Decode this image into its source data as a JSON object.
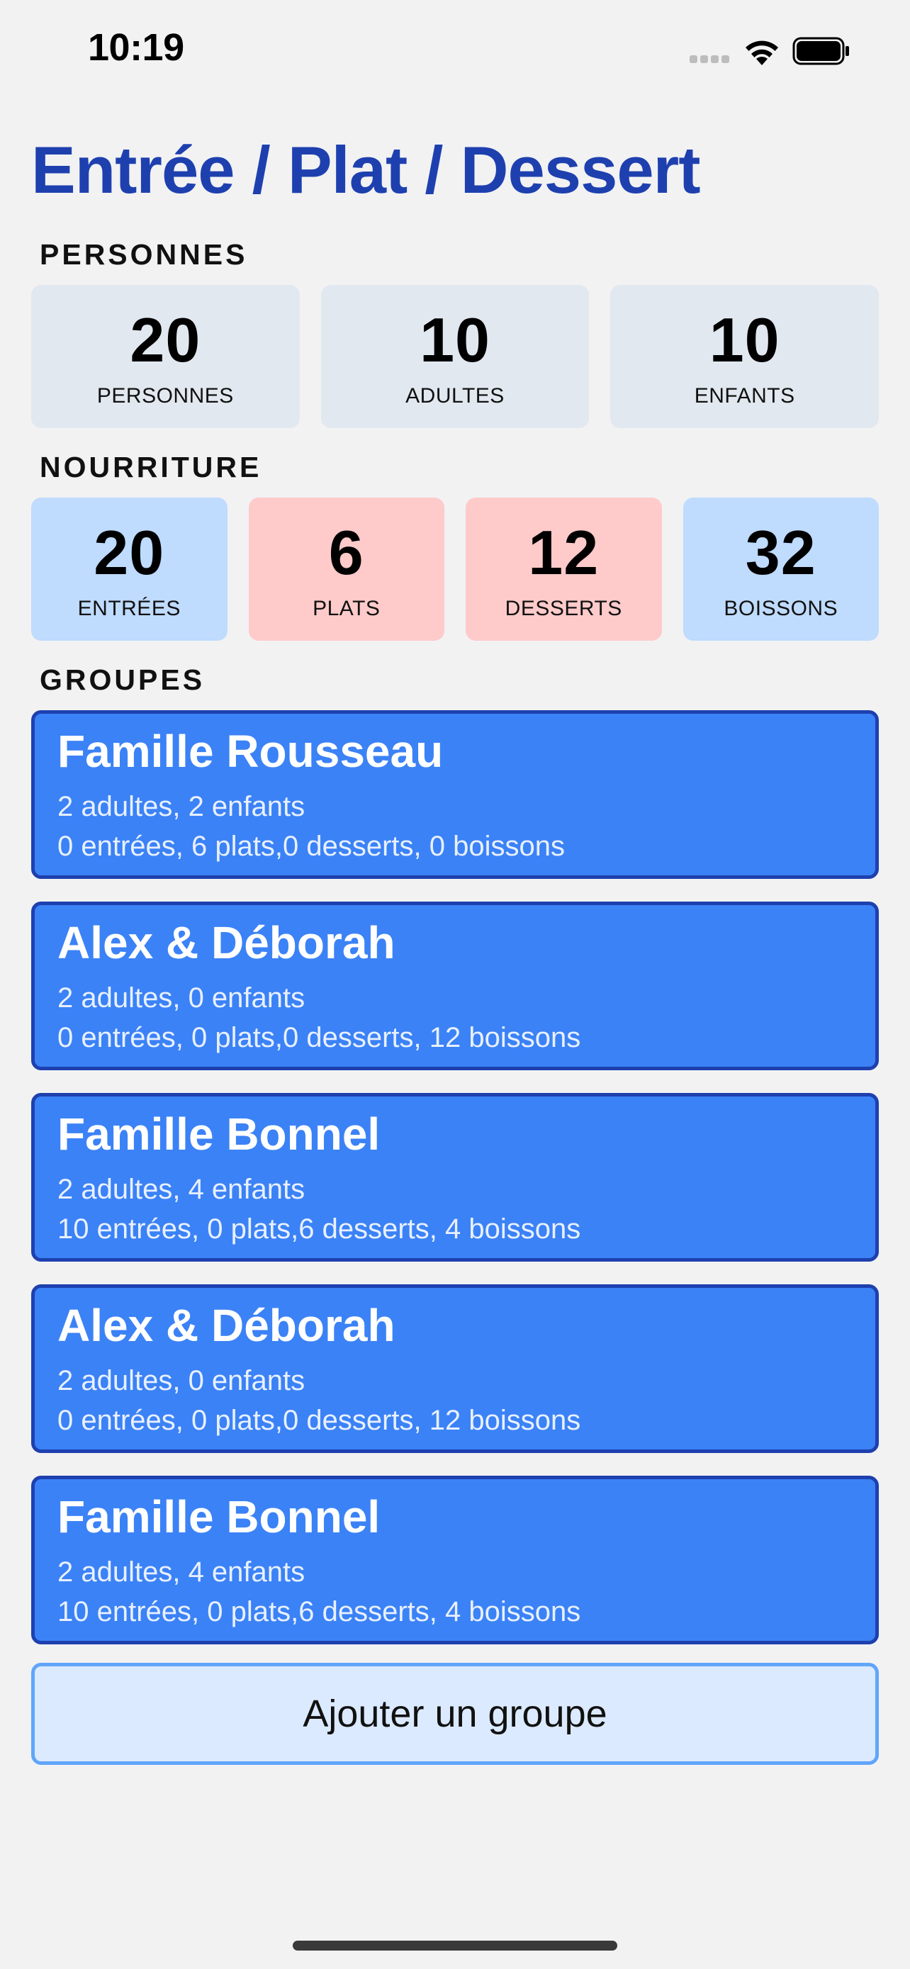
{
  "status_bar": {
    "time": "10:19",
    "icons": [
      "cellular-signal-icon",
      "wifi-icon",
      "battery-icon"
    ]
  },
  "page": {
    "title": "Entrée / Plat / Dessert"
  },
  "personnes": {
    "section_label": "PERSONNES",
    "cards": [
      {
        "value": "20",
        "label": "PERSONNES",
        "color": "#e2e8f0"
      },
      {
        "value": "10",
        "label": "ADULTES",
        "color": "#e2e8f0"
      },
      {
        "value": "10",
        "label": "ENFANTS",
        "color": "#e2e8f0"
      }
    ]
  },
  "nourriture": {
    "section_label": "NOURRITURE",
    "cards": [
      {
        "value": "20",
        "label": "ENTRÉES",
        "color": "#bfdbfe"
      },
      {
        "value": "6",
        "label": "PLATS",
        "color": "#fecaca"
      },
      {
        "value": "12",
        "label": "DESSERTS",
        "color": "#fecaca"
      },
      {
        "value": "32",
        "label": "BOISSONS",
        "color": "#bfdbfe"
      }
    ]
  },
  "groupes": {
    "section_label": "GROUPES",
    "items": [
      {
        "name": "Famille Rousseau",
        "people": "2 adultes, 2 enfants",
        "food": "0 entrées, 6 plats,0 desserts, 0 boissons"
      },
      {
        "name": "Alex & Déborah",
        "people": "2 adultes, 0 enfants",
        "food": "0 entrées, 0 plats,0 desserts, 12 boissons"
      },
      {
        "name": "Famille Bonnel",
        "people": "2 adultes, 4 enfants",
        "food": "10 entrées, 0 plats,6 desserts, 4 boissons"
      },
      {
        "name": "Alex & Déborah",
        "people": "2 adultes, 0 enfants",
        "food": "0 entrées, 0 plats,0 desserts, 12 boissons"
      },
      {
        "name": "Famille Bonnel",
        "people": "2 adultes, 4 enfants",
        "food": "10 entrées, 0 plats,6 desserts, 4 boissons"
      }
    ],
    "add_button_label": "Ajouter un groupe"
  },
  "colors": {
    "title": "#1e40af",
    "group_card_bg": "#3b82f6",
    "group_card_border": "#1e40af",
    "add_button_bg": "#dbeafe",
    "add_button_border": "#60a5fa",
    "page_bg": "#f2f2f3"
  }
}
